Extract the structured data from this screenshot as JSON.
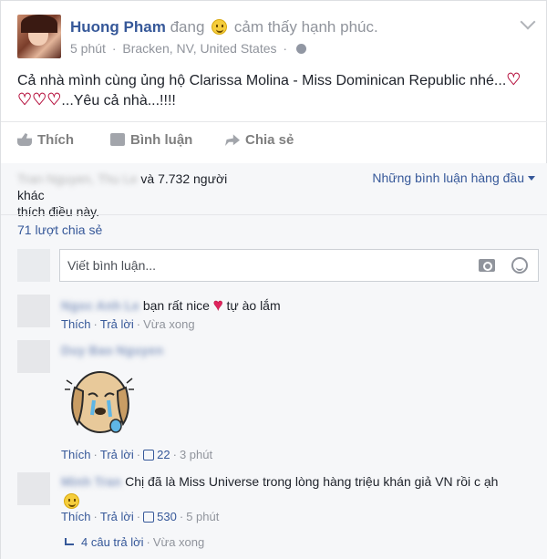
{
  "post": {
    "author": "Huong Pham",
    "feeling_prefix": "đang",
    "feeling": "cảm thấy hạnh phúc.",
    "time": "5 phút",
    "location": "Bracken, NV, United States",
    "text_line1": "Cả nhà mình cùng ủng hộ Clarissa Molina - Miss Dominican Republic nhé...",
    "text_line2": "...Yêu cả nhà...!!!!"
  },
  "actions": {
    "like": "Thích",
    "comment": "Bình luận",
    "share": "Chia sẻ"
  },
  "summary": {
    "likes_count_text": "và 7.732 người khác",
    "likes_suffix": "thích điều này.",
    "top_comments": "Những bình luận hàng đầu",
    "shares": "71 lượt chia sẻ"
  },
  "comment_input": {
    "placeholder": "Viết bình luận..."
  },
  "comments": [
    {
      "text_before": "bạn rất nice",
      "text_after": "tự ào lắm",
      "like": "Thích",
      "reply": "Trả lời",
      "time": "Vừa xong"
    },
    {
      "like": "Thích",
      "reply": "Trả lời",
      "likes": "22",
      "time": "3 phút"
    },
    {
      "text": "Chị đã là Miss Universe trong lòng hàng triệu khán giả VN rồi c ạh",
      "like": "Thích",
      "reply": "Trả lời",
      "likes": "530",
      "time": "5 phút"
    }
  ],
  "replies": {
    "text": "4 câu trả lời",
    "time": "Vừa xong"
  },
  "colors": {
    "link": "#365899",
    "meta": "#90949c",
    "heart": "#e0245e"
  }
}
